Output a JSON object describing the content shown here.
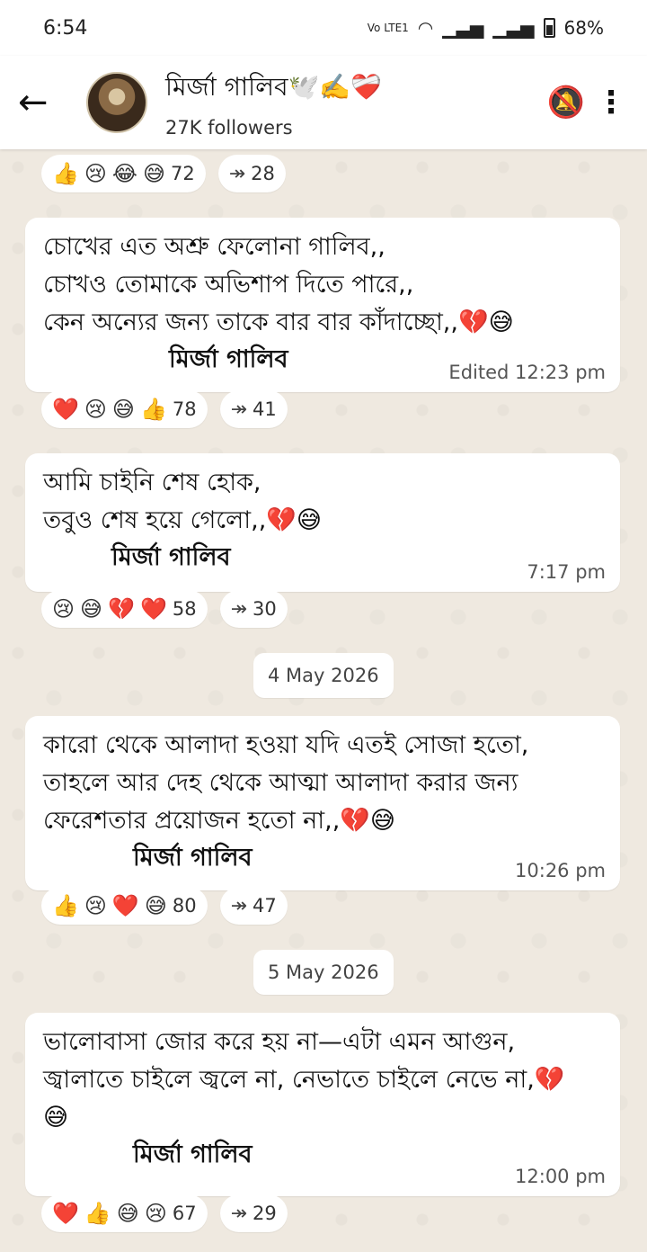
{
  "status_bar": {
    "time": "6:54",
    "network": "Vo LTE1",
    "battery": "68%"
  },
  "header": {
    "back_icon": "back-arrow-icon",
    "channel_name": "মির্জা গালিব🕊️✍️❤️‍🩹",
    "followers": "27K followers",
    "mute_icon": "bell-off-icon",
    "more_icon": "more-vert-icon"
  },
  "messages": [
    {
      "reactions": {
        "emojis": [
          "👍",
          "😢",
          "😂",
          "😅"
        ],
        "count": "72",
        "forwards": "28"
      }
    },
    {
      "lines": [
        "চোখের এত অশ্রু ফেলোনা গালিব,,",
        "চোখও তোমাকে অভিশাপ দিতে পারে,,",
        "কেন অন্যের জন্য  তাকে বার বার কাঁদাচ্ছো,,💔😅"
      ],
      "signature": "মির্জা গালিব",
      "time": "Edited 12:23 pm",
      "reactions": {
        "emojis": [
          "❤️",
          "😢",
          "😅",
          "👍"
        ],
        "count": "78",
        "forwards": "41"
      }
    },
    {
      "lines": [
        "আমি চাইনি শেষ হোক,",
        "তবুও শেষ হয়ে গেলো,,💔😅"
      ],
      "signature": "মির্জা গালিব",
      "time": "7:17 pm",
      "reactions": {
        "emojis": [
          "😢",
          "😅",
          "💔",
          "❤️"
        ],
        "count": "58",
        "forwards": "30"
      }
    },
    {
      "date": "4 May 2026",
      "lines": [
        "কারো থেকে আলাদা হওয়া যদি এতই সোজা হতো,",
        "তাহলে আর  দেহ থেকে আত্মা আলাদা করার জন্য",
        "ফেরেশতার প্রয়োজন হতো না,,💔😅"
      ],
      "signature": "মির্জা গালিব",
      "time": "10:26 pm",
      "reactions": {
        "emojis": [
          "👍",
          "😢",
          "❤️",
          "😅"
        ],
        "count": "80",
        "forwards": "47"
      }
    },
    {
      "date": "5 May 2026",
      "lines": [
        "ভালোবাসা জোর করে হয় না—এটা এমন আগুন,",
        "জ্বালাতে চাইলে জ্বলে না, নেভাতে চাইলে নেভে না,💔",
        "😅"
      ],
      "signature": "মির্জা গালিব",
      "time": "12:00 pm",
      "reactions": {
        "emojis": [
          "❤️",
          "👍",
          "😅",
          "😢"
        ],
        "count": "67",
        "forwards": "29"
      }
    }
  ]
}
